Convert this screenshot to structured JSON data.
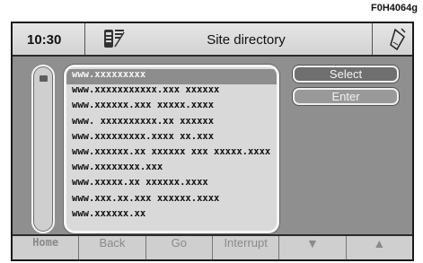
{
  "figure_code": "F0H4064g",
  "header": {
    "time": "10:30",
    "title": "Site directory",
    "signal_icon": "phone-signal-icon",
    "phone_icon": "mobile-phone-icon"
  },
  "list": {
    "items": [
      "www.xxxxxxxxx",
      "www.xxxxxxxxxxx.xxx xxxxxx",
      "www.xxxxxx.xxx xxxxx.xxxx",
      "www. xxxxxxxxxx.xx xxxxxx",
      "www.xxxxxxxxx.xxxx xx.xxx",
      "www.xxxxxx.xx xxxxxx xxx xxxxx.xxxx",
      "www.xxxxxxxx.xxx",
      "www.xxxxx.xx xxxxxx.xxxx",
      "www.xxx.xx.xxx xxxxxx.xxxx",
      "www.xxxxxx.xx"
    ],
    "selected_index": 0
  },
  "side_buttons": {
    "select": "Select",
    "enter": "Enter"
  },
  "bottom_bar": {
    "home": "Home",
    "back": "Back",
    "go": "Go",
    "interrupt": "Interrupt",
    "down": "▼",
    "up": "▲"
  },
  "colors": {
    "background": "#8f8f8f",
    "header": "#dcdcdc",
    "list_bg": "#d9d9d9",
    "selected_row": "#8d8d8d",
    "select_button": "#6f6f6f"
  }
}
